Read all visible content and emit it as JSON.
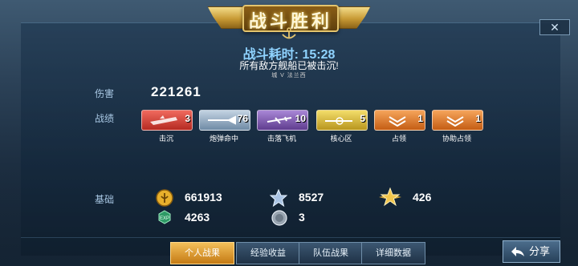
{
  "banner": {
    "title": "战斗胜利"
  },
  "header": {
    "duration_label": "战斗耗时:",
    "duration_value": "15:28",
    "sunk_message": "所有敌方舰船已被击沉!",
    "mini_info": "城  V  法兰西"
  },
  "stats": {
    "damage_label": "伤害",
    "damage_value": "221261",
    "record_label": "战绩",
    "badges": [
      {
        "label": "击沉",
        "count": "3",
        "color": "#d8443c"
      },
      {
        "label": "炮弹命中",
        "count": "76",
        "color": "#8fa7c0"
      },
      {
        "label": "击落飞机",
        "count": "10",
        "color": "#8a62b8"
      },
      {
        "label": "核心区",
        "count": "5",
        "color": "#d8b83a"
      },
      {
        "label": "占领",
        "count": "1",
        "color": "#e0812e"
      },
      {
        "label": "协助占领",
        "count": "1",
        "color": "#e0812e"
      }
    ]
  },
  "basic": {
    "label": "基础",
    "gold": "661913",
    "exp": "4263",
    "star_points": "8527",
    "silver": "3",
    "rank_points": "426"
  },
  "tabs": [
    "个人战果",
    "经验收益",
    "队伍战果",
    "详细数据"
  ],
  "active_tab": 0,
  "share_label": "分享",
  "close_glyph": "✕",
  "colors": {
    "accent_blue": "#8fd3ff",
    "gold": "#f2c64c",
    "active_tab": "#e89c2c"
  }
}
